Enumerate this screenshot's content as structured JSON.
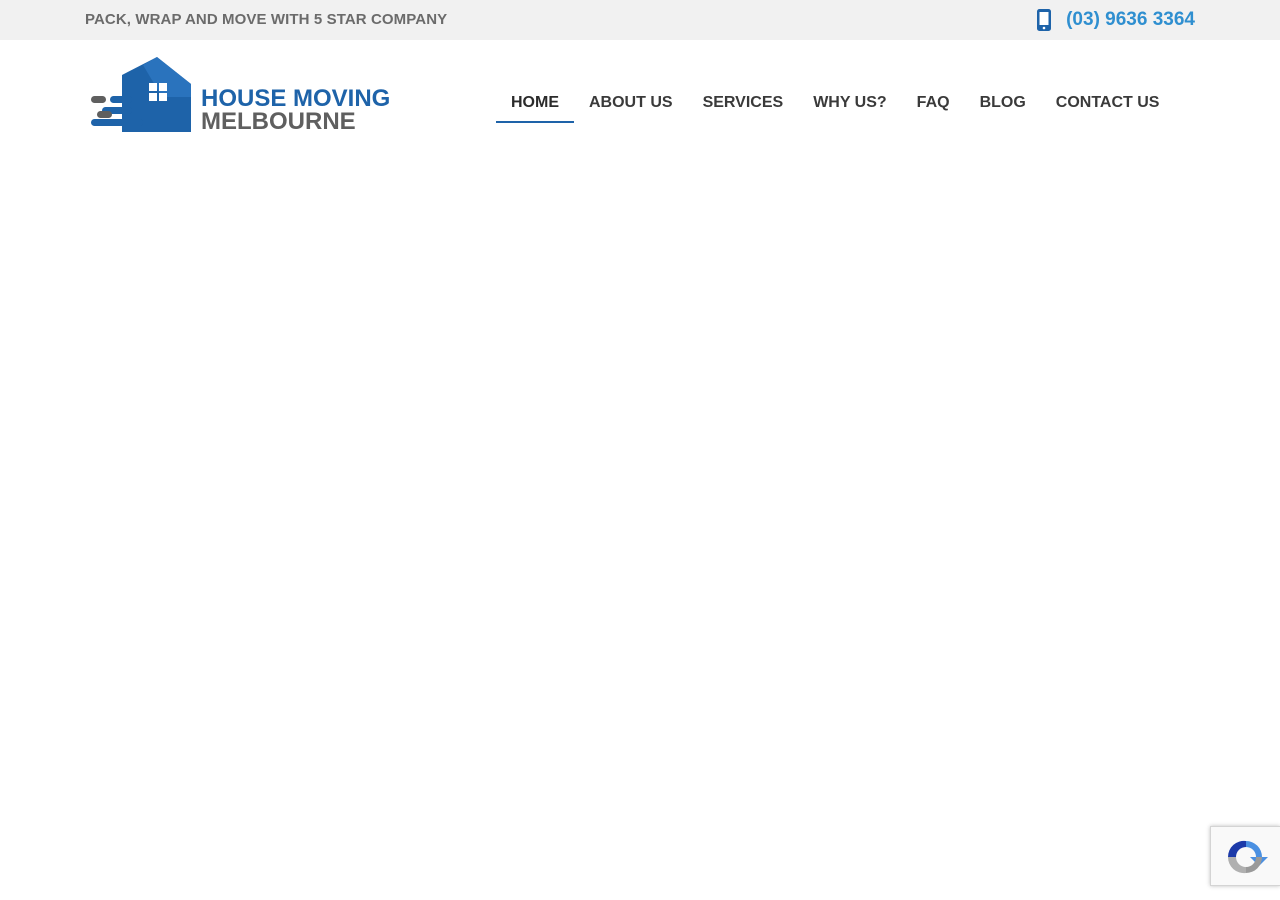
{
  "topbar": {
    "tagline": "PACK, WRAP AND MOVE WITH 5 STAR COMPANY",
    "phone_icon": "mobile-phone-icon",
    "phone_number": "(03) 9636 3364"
  },
  "header": {
    "logo_icon": "house-moving-logo-icon",
    "logo_line1": "HOUSE MOVING",
    "logo_line2": "MELBOURNE"
  },
  "nav": {
    "items": [
      {
        "label": "HOME",
        "active": true
      },
      {
        "label": "ABOUT US",
        "active": false
      },
      {
        "label": "SERVICES",
        "active": false
      },
      {
        "label": "WHY US?",
        "active": false
      },
      {
        "label": "FAQ",
        "active": false
      },
      {
        "label": "BLOG",
        "active": false
      },
      {
        "label": "CONTACT US",
        "active": false
      }
    ]
  },
  "recaptcha": {
    "icon": "recaptcha-icon"
  },
  "colors": {
    "brand_blue": "#1e63a9",
    "link_blue": "#2f8fd0",
    "brand_gray": "#5f5f5f",
    "topbar_bg": "#f1f1f1"
  }
}
